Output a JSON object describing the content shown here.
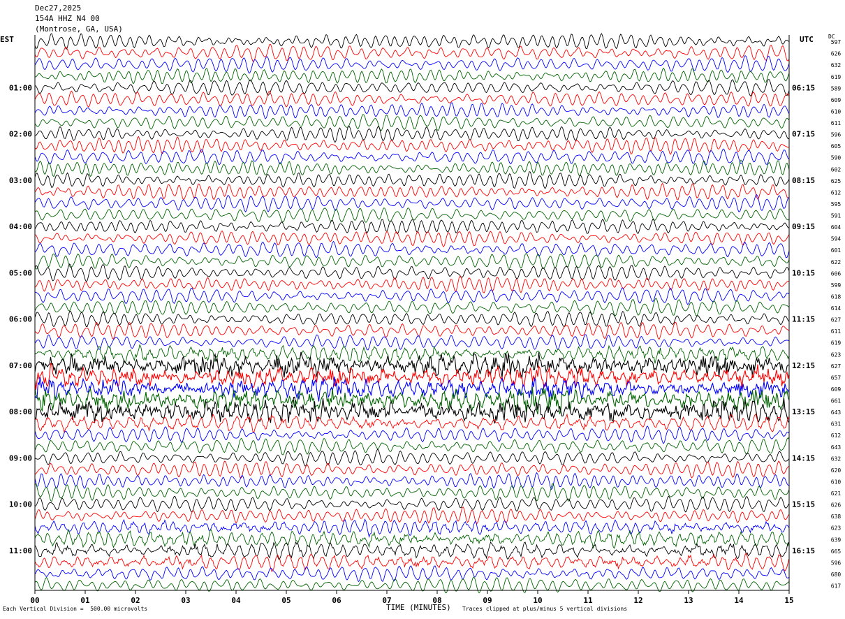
{
  "header": {
    "date": "Dec27,2025",
    "station": "154A HHZ N4 00",
    "location": "(Montrose, GA, USA)"
  },
  "labels": {
    "tz_left": "EST",
    "tz_right": "UTC",
    "dc": "DC",
    "xlabel": "TIME (MINUTES)",
    "scale_note": "Each Vertical Division =  500.00 microvolts",
    "clip_note": "Traces clipped at plus/minus 5 vertical divisions"
  },
  "chart_data": {
    "type": "line",
    "title": "",
    "xlabel": "TIME (MINUTES)",
    "xlim": [
      0,
      15
    ],
    "x_ticks": [
      "00",
      "01",
      "02",
      "03",
      "04",
      "05",
      "06",
      "07",
      "08",
      "09",
      "10",
      "11",
      "12",
      "13",
      "14",
      "15"
    ],
    "left_hour_labels": [
      "01:00",
      "02:00",
      "03:00",
      "04:00",
      "05:00",
      "06:00",
      "07:00",
      "08:00",
      "09:00",
      "10:00",
      "11:00"
    ],
    "right_hour_labels": [
      "06:15",
      "07:15",
      "08:15",
      "09:15",
      "10:15",
      "11:15",
      "12:15",
      "13:15",
      "14:15",
      "15:15",
      "16:15"
    ],
    "trace_colors": [
      "#000000",
      "#ff0000",
      "#0000ff",
      "#006400"
    ],
    "dc_offsets": [
      597,
      626,
      632,
      619,
      589,
      609,
      610,
      611,
      596,
      605,
      590,
      602,
      625,
      612,
      595,
      591,
      604,
      594,
      601,
      622,
      606,
      599,
      618,
      614,
      627,
      611,
      619,
      623,
      627,
      657,
      609,
      661,
      643,
      631,
      612,
      643,
      632,
      620,
      610,
      621,
      626,
      638,
      623,
      639,
      665,
      596,
      680,
      617
    ],
    "event_intensity": [
      0,
      0,
      0,
      0,
      0,
      0,
      0,
      0,
      0,
      0,
      0,
      0,
      0,
      0,
      0,
      0,
      0,
      0,
      0,
      0,
      0,
      0,
      0,
      0,
      0,
      0,
      0,
      0.4,
      1,
      0.8,
      0.8,
      1,
      1,
      0.3,
      0,
      0,
      0,
      0,
      0,
      0,
      0,
      0,
      0.25,
      0.35,
      0.35,
      0.3,
      0,
      0
    ],
    "seed": 1227
  }
}
